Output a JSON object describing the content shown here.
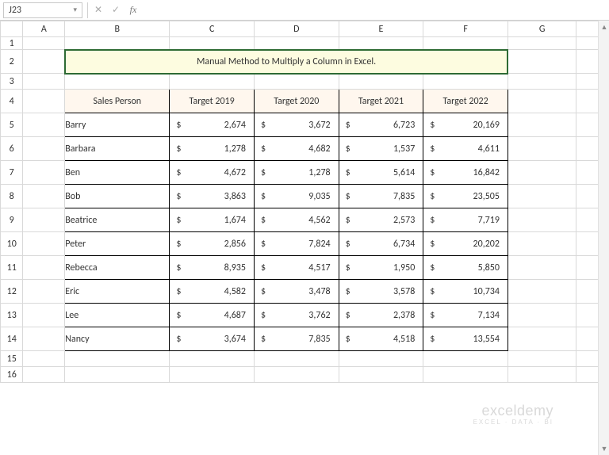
{
  "namebox": {
    "value": "J23"
  },
  "formula_bar": {
    "cancel_glyph": "✕",
    "confirm_glyph": "✓",
    "fx_glyph": "fx",
    "value": ""
  },
  "columns": [
    "A",
    "B",
    "C",
    "D",
    "E",
    "F",
    "G",
    ""
  ],
  "row_numbers": [
    "1",
    "2",
    "3",
    "4",
    "5",
    "6",
    "7",
    "8",
    "9",
    "10",
    "11",
    "12",
    "13",
    "14",
    "15",
    "16"
  ],
  "title": "Manual Method to Multiply a Column in Excel.",
  "headers": {
    "sales_person": "Sales Person",
    "t2019": "Target 2019",
    "t2020": "Target 2020",
    "t2021": "Target 2021",
    "t2022": "Target 2022"
  },
  "currency_symbol": "$",
  "rows": [
    {
      "name": "Barry",
      "t2019": "2,674",
      "t2020": "3,672",
      "t2021": "6,723",
      "t2022": "20,169"
    },
    {
      "name": "Barbara",
      "t2019": "1,278",
      "t2020": "4,682",
      "t2021": "1,537",
      "t2022": "4,611"
    },
    {
      "name": "Ben",
      "t2019": "4,672",
      "t2020": "1,278",
      "t2021": "5,614",
      "t2022": "16,842"
    },
    {
      "name": "Bob",
      "t2019": "3,863",
      "t2020": "9,035",
      "t2021": "7,835",
      "t2022": "23,505"
    },
    {
      "name": "Beatrice",
      "t2019": "1,674",
      "t2020": "4,562",
      "t2021": "2,573",
      "t2022": "7,719"
    },
    {
      "name": "Peter",
      "t2019": "2,856",
      "t2020": "7,824",
      "t2021": "6,734",
      "t2022": "20,202"
    },
    {
      "name": "Rebecca",
      "t2019": "8,935",
      "t2020": "4,517",
      "t2021": "1,950",
      "t2022": "5,850"
    },
    {
      "name": "Eric",
      "t2019": "4,582",
      "t2020": "3,478",
      "t2021": "3,578",
      "t2022": "10,734"
    },
    {
      "name": "Lee",
      "t2019": "4,687",
      "t2020": "3,762",
      "t2021": "2,378",
      "t2022": "7,134"
    },
    {
      "name": "Nancy",
      "t2019": "3,674",
      "t2020": "7,835",
      "t2021": "4,518",
      "t2022": "13,554"
    }
  ],
  "watermark": {
    "line1": "exceldemy",
    "line2": "EXCEL · DATA · BI"
  },
  "scroll": {
    "up_glyph": "▲",
    "down_glyph": "▼"
  },
  "chart_data": {
    "type": "table",
    "title": "Manual Method to Multiply a Column in Excel.",
    "columns": [
      "Sales Person",
      "Target 2019",
      "Target 2020",
      "Target 2021",
      "Target 2022"
    ],
    "rows": [
      [
        "Barry",
        2674,
        3672,
        6723,
        20169
      ],
      [
        "Barbara",
        1278,
        4682,
        1537,
        4611
      ],
      [
        "Ben",
        4672,
        1278,
        5614,
        16842
      ],
      [
        "Bob",
        3863,
        9035,
        7835,
        23505
      ],
      [
        "Beatrice",
        1674,
        4562,
        2573,
        7719
      ],
      [
        "Peter",
        2856,
        7824,
        6734,
        20202
      ],
      [
        "Rebecca",
        8935,
        4517,
        1950,
        5850
      ],
      [
        "Eric",
        4582,
        3478,
        3578,
        10734
      ],
      [
        "Lee",
        4687,
        3762,
        2378,
        7134
      ],
      [
        "Nancy",
        3674,
        7835,
        4518,
        13554
      ]
    ]
  }
}
